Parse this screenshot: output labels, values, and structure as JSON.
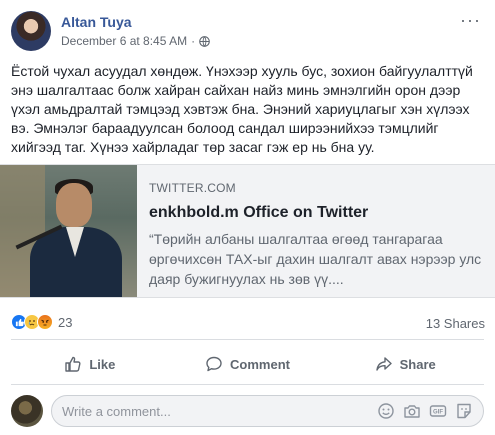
{
  "post": {
    "author": "Altan Tuya",
    "timestamp": "December 6 at 8:45 AM",
    "separator": "·",
    "privacy_icon": "globe-icon",
    "more_label": "···",
    "text": "Ёстой чухал асуудал хөндөж. Үнэхээр хууль бус, зохион байгуулалттүй энэ шалгалтаас болж хайран сайхан найз минь эмнэлгийн орон дээр үхэл амьдралтай тэмцээд хэвтэж бна. Энэний хариуцлагыг хэн хүлээх вэ. Эмнэлэг бараадуулсан болоод сандал ширээнийхээ тэмцлийг хийгээд таг. Хүнээ хайрладаг төр засаг гэж ер нь бна уу."
  },
  "link_preview": {
    "domain": "TWITTER.COM",
    "title": "enkhbold.m Office on Twitter",
    "description": "“Төрийн албаны шалгалтаа өгөөд тангарагаа өргөчихсөн ТАХ-ыг дахин шалгалт авах нэрээр улс даяр бужигнуулах нь зөв үү...."
  },
  "stats": {
    "reaction_icons": [
      "like-icon",
      "sad-icon",
      "angry-icon"
    ],
    "reaction_count": "23",
    "shares": "13 Shares"
  },
  "actions": {
    "like": "Like",
    "comment": "Comment",
    "share": "Share"
  },
  "comment_box": {
    "placeholder": "Write a comment...",
    "icons": [
      "emoji-icon",
      "camera-icon",
      "gif-icon",
      "sticker-icon"
    ]
  },
  "colors": {
    "author_link": "#385898",
    "like_blue": "#1877f2",
    "secondary_text": "#606770"
  }
}
